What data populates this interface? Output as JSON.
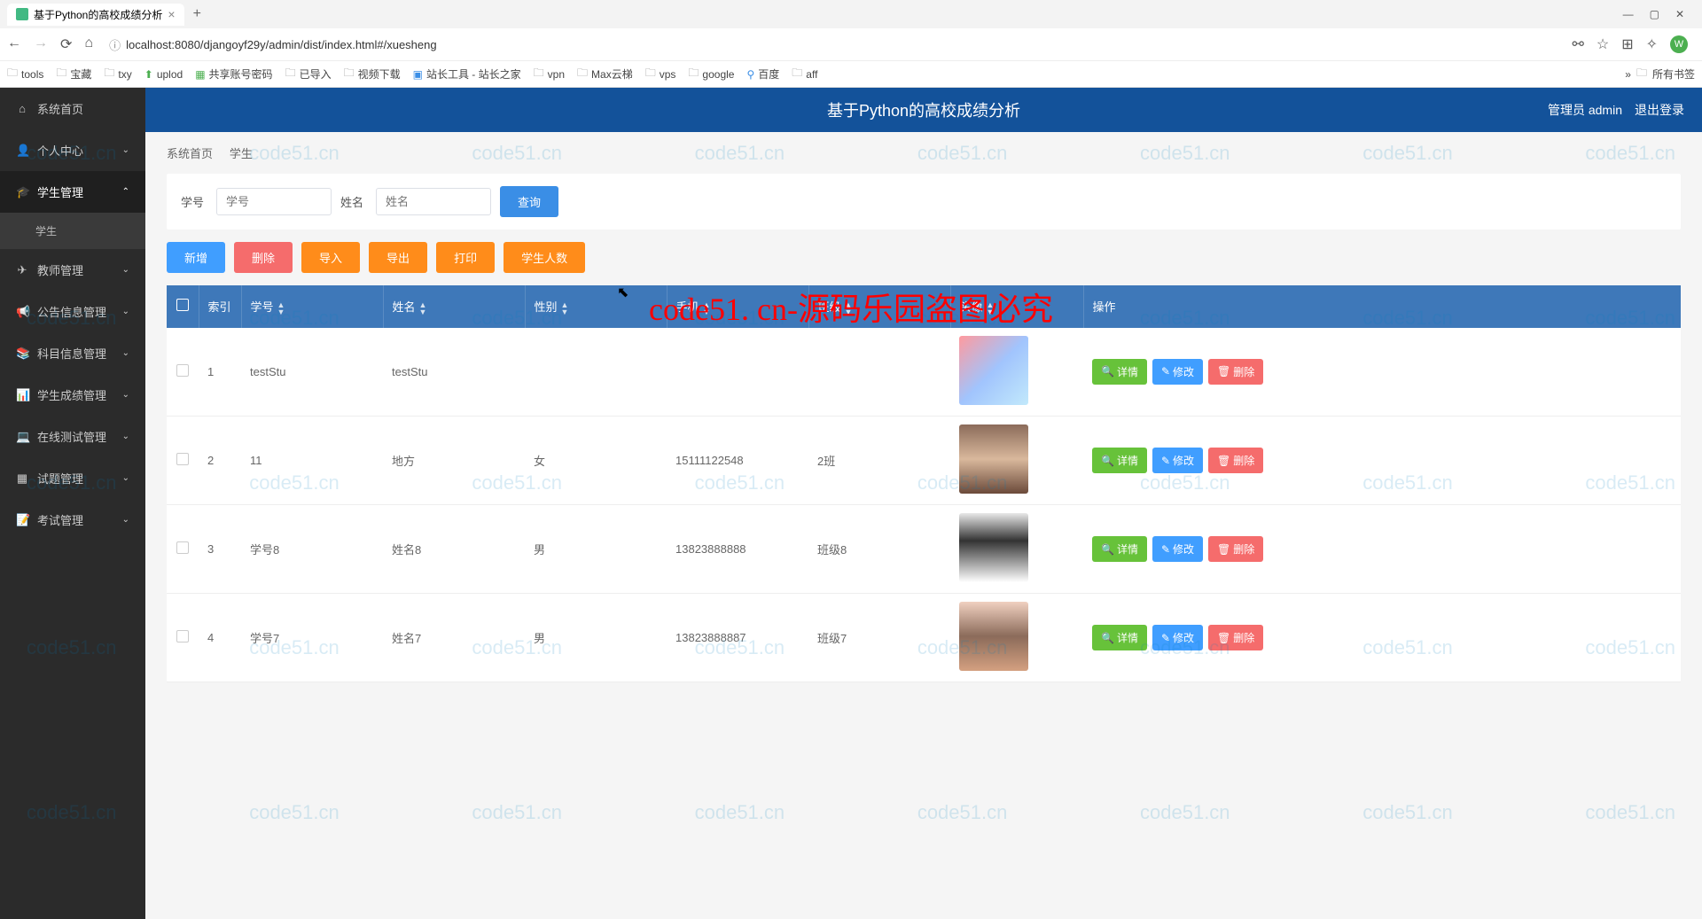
{
  "browser": {
    "tab_title": "基于Python的高校成绩分析",
    "url": "localhost:8080/djangoyf29y/admin/dist/index.html#/xuesheng",
    "bookmarks": [
      "tools",
      "宝藏",
      "txy",
      "uplod",
      "共享账号密码",
      "已导入",
      "视频下载",
      "站长工具 - 站长之家",
      "vpn",
      "Max云梯",
      "vps",
      "google",
      "百度",
      "aff"
    ],
    "all_bookmarks": "所有书签"
  },
  "header": {
    "title": "基于Python的高校成绩分析",
    "user_label": "管理员 admin",
    "logout": "退出登录"
  },
  "sidebar": {
    "items": [
      {
        "icon": "⌂",
        "label": "系统首页",
        "expandable": false
      },
      {
        "icon": "👤",
        "label": "个人中心",
        "expandable": true
      },
      {
        "icon": "🎓",
        "label": "学生管理",
        "expandable": true,
        "expanded": true,
        "children": [
          "学生"
        ]
      },
      {
        "icon": "✈",
        "label": "教师管理",
        "expandable": true
      },
      {
        "icon": "📢",
        "label": "公告信息管理",
        "expandable": true
      },
      {
        "icon": "📚",
        "label": "科目信息管理",
        "expandable": true
      },
      {
        "icon": "📊",
        "label": "学生成绩管理",
        "expandable": true
      },
      {
        "icon": "💻",
        "label": "在线测试管理",
        "expandable": true
      },
      {
        "icon": "▦",
        "label": "试题管理",
        "expandable": true
      },
      {
        "icon": "📝",
        "label": "考试管理",
        "expandable": true
      }
    ]
  },
  "breadcrumb": {
    "home": "系统首页",
    "current": "学生"
  },
  "search": {
    "field1_label": "学号",
    "field1_placeholder": "学号",
    "field2_label": "姓名",
    "field2_placeholder": "姓名",
    "submit": "查询"
  },
  "actions": {
    "add": "新增",
    "delete": "删除",
    "import": "导入",
    "export": "导出",
    "print": "打印",
    "count": "学生人数"
  },
  "table": {
    "headers": [
      "",
      "索引",
      "学号",
      "姓名",
      "性别",
      "手机",
      "班级",
      "头像",
      "操作"
    ],
    "rows": [
      {
        "idx": "1",
        "sid": "testStu",
        "name": "testStu",
        "gender": "",
        "phone": "",
        "class": ""
      },
      {
        "idx": "2",
        "sid": "11",
        "name": "地方",
        "gender": "女",
        "phone": "15111122548",
        "class": "2班"
      },
      {
        "idx": "3",
        "sid": "学号8",
        "name": "姓名8",
        "gender": "男",
        "phone": "13823888888",
        "class": "班级8"
      },
      {
        "idx": "4",
        "sid": "学号7",
        "name": "姓名7",
        "gender": "男",
        "phone": "13823888887",
        "class": "班级7"
      }
    ],
    "row_actions": {
      "detail": "详情",
      "edit": "修改",
      "delete": "删除"
    }
  },
  "watermark": {
    "text": "code51.cn",
    "big": "code51. cn-源码乐园盗图必究"
  }
}
